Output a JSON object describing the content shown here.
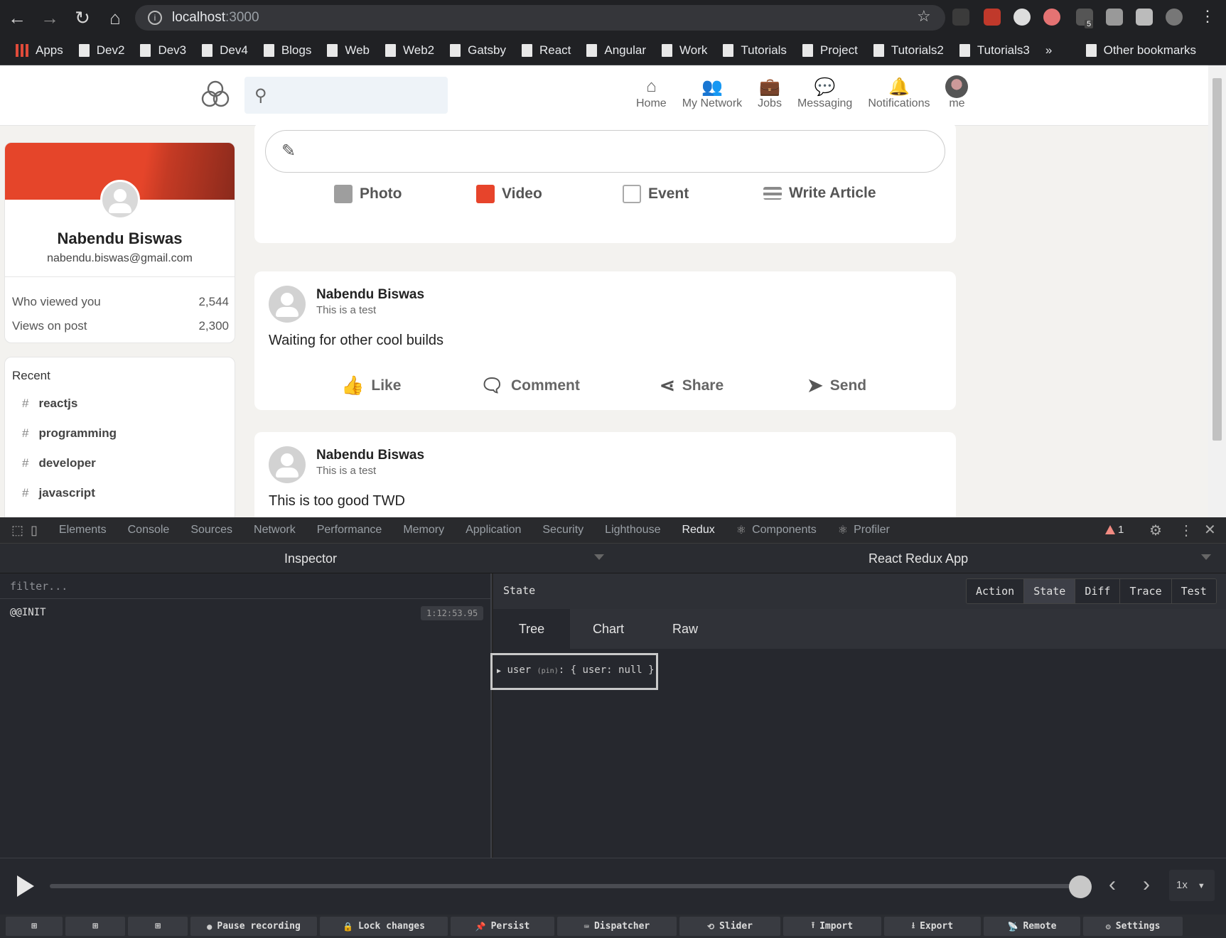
{
  "browser": {
    "url_host": "localhost",
    "url_port": ":3000",
    "bookmarks": [
      "Apps",
      "Dev2",
      "Dev3",
      "Dev4",
      "Blogs",
      "Web",
      "Web2",
      "Gatsby",
      "React",
      "Angular",
      "Work",
      "Tutorials",
      "Project",
      "Tutorials2",
      "Tutorials3"
    ],
    "overflow_label": "»",
    "other_bookmarks": "Other bookmarks",
    "ext_badge": "5"
  },
  "app": {
    "nav": {
      "home": "Home",
      "network": "My Network",
      "jobs": "Jobs",
      "messaging": "Messaging",
      "notifications": "Notifications",
      "me": "me"
    },
    "profile": {
      "name": "Nabendu Biswas",
      "email": "nabendu.biswas@gmail.com",
      "stat1_label": "Who viewed you",
      "stat1_value": "2,544",
      "stat2_label": "Views on post",
      "stat2_value": "2,300"
    },
    "recent": {
      "title": "Recent",
      "items": [
        "reactjs",
        "programming",
        "developer",
        "javascript"
      ]
    },
    "input_options": {
      "photo": "Photo",
      "video": "Video",
      "event": "Event",
      "article": "Write Article"
    },
    "posts": [
      {
        "name": "Nabendu Biswas",
        "description": "This is a test",
        "message": "Waiting for other cool builds"
      },
      {
        "name": "Nabendu Biswas",
        "description": "This is a test",
        "message": "This is too good TWD"
      }
    ],
    "post_actions": {
      "like": "Like",
      "comment": "Comment",
      "share": "Share",
      "send": "Send"
    }
  },
  "devtools": {
    "tabs": [
      "Elements",
      "Console",
      "Sources",
      "Network",
      "Performance",
      "Memory",
      "Application",
      "Security",
      "Lighthouse",
      "Redux",
      "Components",
      "Profiler"
    ],
    "active_tab": "Redux",
    "warning_count": "1",
    "inspector_title": "Inspector",
    "instance_title": "React Redux App",
    "filter_placeholder": "filter...",
    "action": {
      "name": "@@INIT",
      "time": "1:12:53.95"
    },
    "state_label": "State",
    "monitor_buttons": [
      "Action",
      "State",
      "Diff",
      "Trace",
      "Test"
    ],
    "active_monitor": "State",
    "subtabs": [
      "Tree",
      "Chart",
      "Raw"
    ],
    "active_subtab": "Tree",
    "tree": {
      "key": "user",
      "pin": "(pin)",
      "value": ": { user: null }"
    },
    "speed": "1x",
    "slider_value": 1.0,
    "footer_buttons": [
      "Pause recording",
      "Lock changes",
      "Persist",
      "Dispatcher",
      "Slider",
      "Import",
      "Export",
      "Remote",
      "Settings"
    ]
  }
}
